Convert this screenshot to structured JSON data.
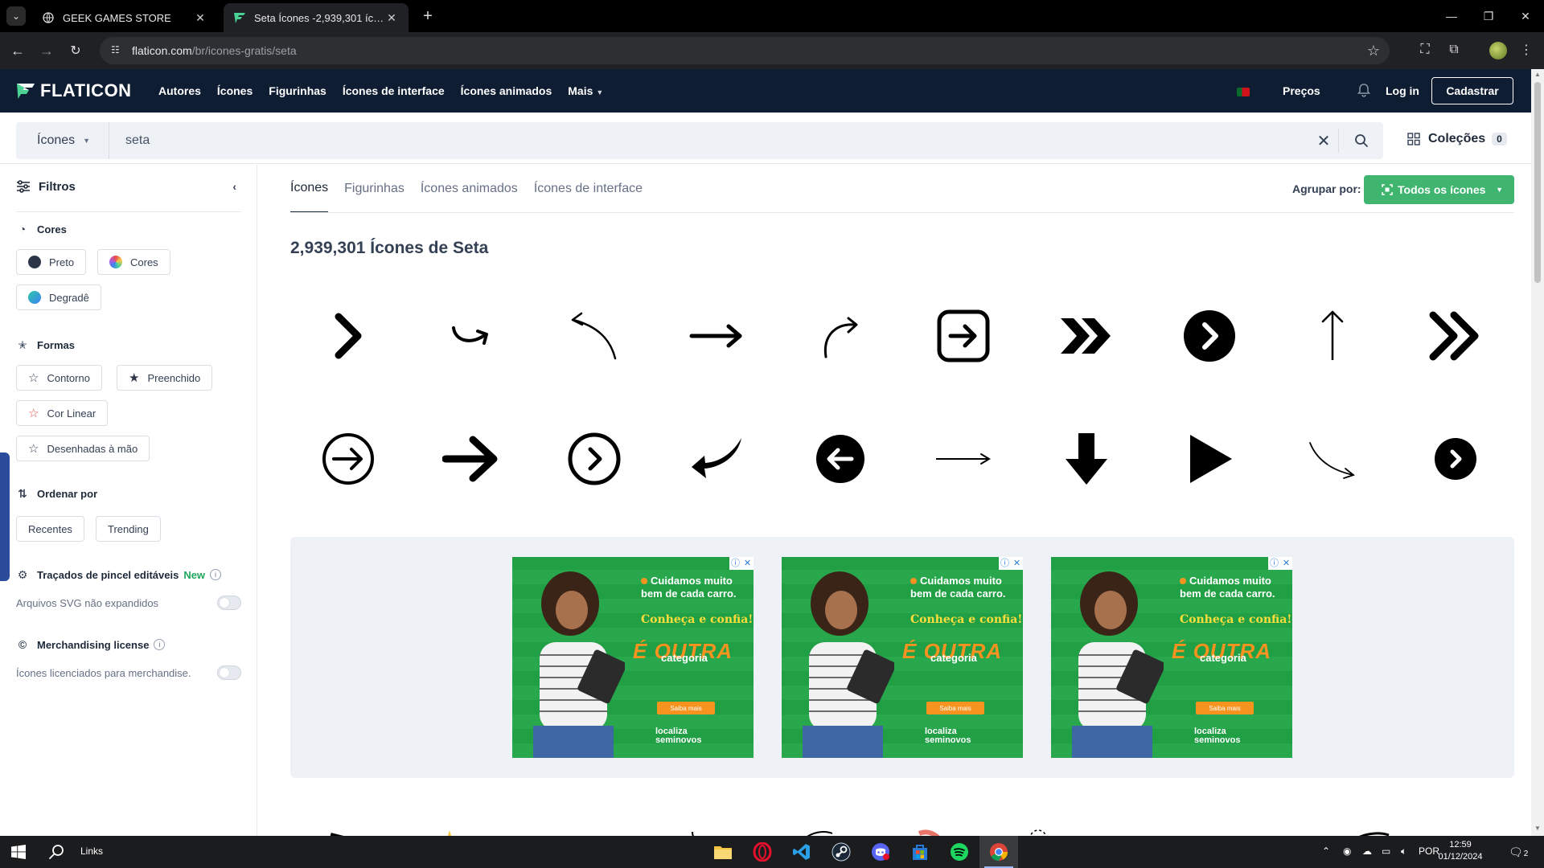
{
  "browser": {
    "tabs": [
      {
        "title": "GEEK GAMES STORE",
        "active": false
      },
      {
        "title": "Seta Ícones -2,939,301 ícones g",
        "active": true
      }
    ],
    "url_host": "flaticon.com",
    "url_path": "/br/icones-gratis/seta"
  },
  "header": {
    "logo": "FLATICON",
    "nav": [
      "Autores",
      "Ícones",
      "Figurinhas",
      "Ícones de interface",
      "Ícones animados",
      "Mais"
    ],
    "pricing": "Preços",
    "login": "Log in",
    "signup": "Cadastrar"
  },
  "search": {
    "type": "Ícones",
    "query": "seta",
    "collections_label": "Coleções",
    "collections_count": "0"
  },
  "sidebar": {
    "title": "Filtros",
    "colors_title": "Cores",
    "colors": [
      "Preto",
      "Cores",
      "Degradê"
    ],
    "shapes_title": "Formas",
    "shapes": [
      "Contorno",
      "Preenchido",
      "Cor Linear",
      "Desenhadas à mão"
    ],
    "order_title": "Ordenar por",
    "order": [
      "Recentes",
      "Trending"
    ],
    "brush_title": "Traçados de pincel editáveis",
    "brush_badge": "New",
    "brush_note": "Arquivos SVG não expandidos",
    "merch_title": "Merchandising license",
    "merch_note": "Ícones licenciados para merchandise."
  },
  "main": {
    "tabs": [
      "Ícones",
      "Figurinhas",
      "Ícones animados",
      "Ícones de interface"
    ],
    "group_label": "Agrupar por:",
    "group_value": "Todos os ícones",
    "results_title": "2,939,301 Ícones de Seta",
    "icons": [
      "chevron-right-icon",
      "curved-arrow-icon",
      "back-curved-arrow-icon",
      "long-right-arrow-icon",
      "curved-up-right-arrow-icon",
      "square-right-arrow-icon",
      "double-chevron-filled-icon",
      "circle-chevron-filled-icon",
      "up-arrow-thin-icon",
      "double-chevron-right-icon",
      "circle-right-arrow-outline-icon",
      "bold-right-arrow-icon",
      "circle-chevron-outline-icon",
      "curved-back-arrow-icon",
      "circle-left-arrow-filled-icon",
      "thin-right-arrow-icon",
      "down-arrow-filled-icon",
      "play-triangle-icon",
      "curved-down-arrow-icon",
      "circle-chevron-right-filled-icon"
    ]
  },
  "ad": {
    "headline": "Cuidamos muito bem de cada carro.",
    "sub": "Conheça e confia!",
    "big": "É OUTRA",
    "cat": "categoria",
    "cta": "Saiba mais",
    "brand_line1": "localiza",
    "brand_line2": "seminovos",
    "count": 3
  },
  "taskbar": {
    "links": "Links",
    "lang": "POR",
    "time": "12:59",
    "date": "01/12/2024",
    "notif": "2"
  },
  "colors": {
    "header_bg": "#0f1d33",
    "accent_green": "#3fb56f",
    "ad_green": "#22a447",
    "ad_orange": "#f7931e"
  }
}
